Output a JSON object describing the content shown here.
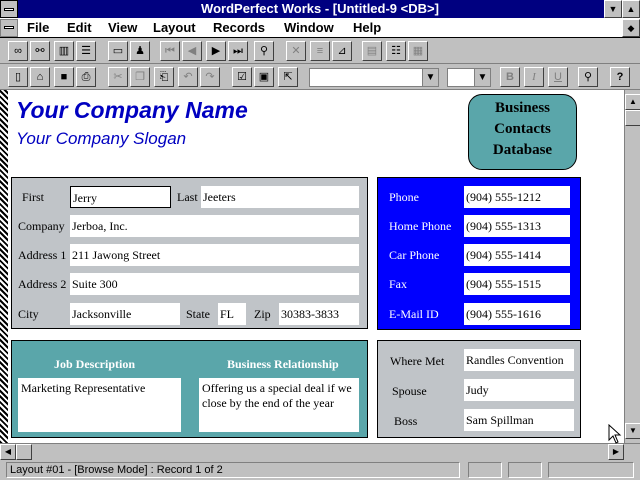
{
  "window": {
    "title": "WordPerfect Works - [Untitled-9 <DB>]",
    "min_glyph": "▼",
    "max_glyph": "▲"
  },
  "menu": [
    "File",
    "Edit",
    "View",
    "Layout",
    "Records",
    "Window",
    "Help"
  ],
  "form": {
    "company_name": "Your Company Name",
    "company_slogan": "Your Company Slogan",
    "badge_lines": [
      "Business",
      "Contacts",
      "Database"
    ],
    "labels": {
      "first": "First",
      "last": "Last",
      "company": "Company",
      "address1": "Address 1",
      "address2": "Address 2",
      "city": "City",
      "state": "State",
      "zip": "Zip",
      "phone": "Phone",
      "home_phone": "Home Phone",
      "car_phone": "Car Phone",
      "fax": "Fax",
      "email": "E-Mail ID",
      "job_description": "Job Description",
      "business_relationship": "Business Relationship",
      "where_met": "Where Met",
      "spouse": "Spouse",
      "boss": "Boss"
    },
    "values": {
      "first": "Jerry",
      "last": "Jeeters",
      "company": "Jerboa, Inc.",
      "address1": "211 Jawong Street",
      "address2": "Suite 300",
      "city": "Jacksonville",
      "state": "FL",
      "zip": "30383-3833",
      "phone": "(904) 555-1212",
      "home_phone": "(904) 555-1313",
      "car_phone": "(904) 555-1414",
      "fax": "(904) 555-1515",
      "email": "(904) 555-1616",
      "job_description": "Marketing Representative",
      "business_relationship": "Offering us a special deal if we close by the end of the year",
      "where_met": "Randles Convention",
      "spouse": "Judy",
      "boss": "Sam Spillman"
    }
  },
  "status": {
    "text": "Layout #01 - [Browse Mode] : Record 1 of 2"
  },
  "colors": {
    "titlebar": "#000080",
    "brand_text": "#0000c0",
    "teal": "#5aa6aa",
    "phone_panel": "#0000ff",
    "panel_gray": "#c0c4c8"
  }
}
